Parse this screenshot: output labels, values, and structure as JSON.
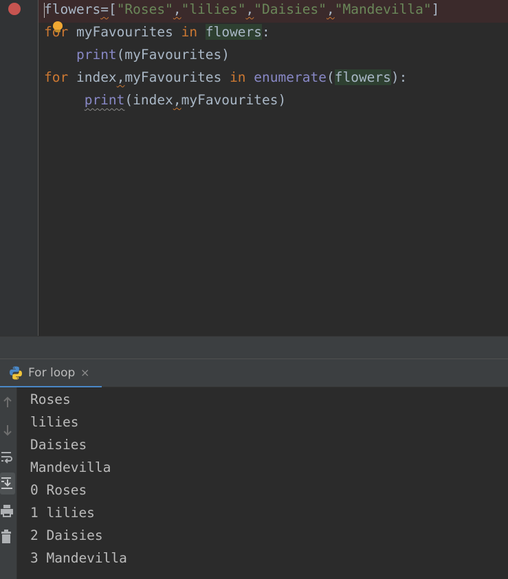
{
  "editor": {
    "line1": {
      "var": "flowers",
      "eq": "=",
      "open": "[",
      "s1": "\"Roses\"",
      "c1": ",",
      "s2": "\"lilies\"",
      "c2": ",",
      "s3": "\"Daisies\"",
      "c3": ",",
      "s4": "\"Mandevilla\"",
      "close": "]"
    },
    "line2": {
      "kw_for": "for",
      "var": " myFavourites ",
      "kw_in": "in",
      "sp": " ",
      "iter": "flowers",
      "colon": ":"
    },
    "line3": {
      "indent": "    ",
      "fn": "print",
      "args": "(myFavourites)"
    },
    "line4": {
      "kw_for": "for",
      "var1": " index",
      "comma": ",",
      "var2": "myFavourites ",
      "kw_in": "in",
      "sp": " ",
      "fn": "enumerate",
      "open": "(",
      "iter": "flowers",
      "close": "):"
    },
    "line5": {
      "indent": "     ",
      "fn": "print",
      "open": "(index",
      "comma": ",",
      "rest": "myFavourites)"
    }
  },
  "run_panel": {
    "tab_label": "For loop",
    "close_glyph": "×"
  },
  "console_output": [
    "Roses",
    "lilies",
    "Daisies",
    "Mandevilla",
    "0 Roses",
    "1 lilies",
    "2 Daisies",
    "3 Mandevilla"
  ],
  "colors": {
    "editor_bg": "#2b2b2b",
    "keyword": "#cc7832",
    "string": "#6a8759",
    "builtin": "#8888c6",
    "breakpoint": "#c75450",
    "tab_accent": "#4a88c7"
  },
  "icons": [
    "breakpoint-icon",
    "lightbulb-icon",
    "python-icon",
    "close-icon",
    "up-arrow-icon",
    "down-arrow-icon",
    "soft-wrap-icon",
    "scroll-to-end-icon",
    "print-icon",
    "trash-icon"
  ]
}
